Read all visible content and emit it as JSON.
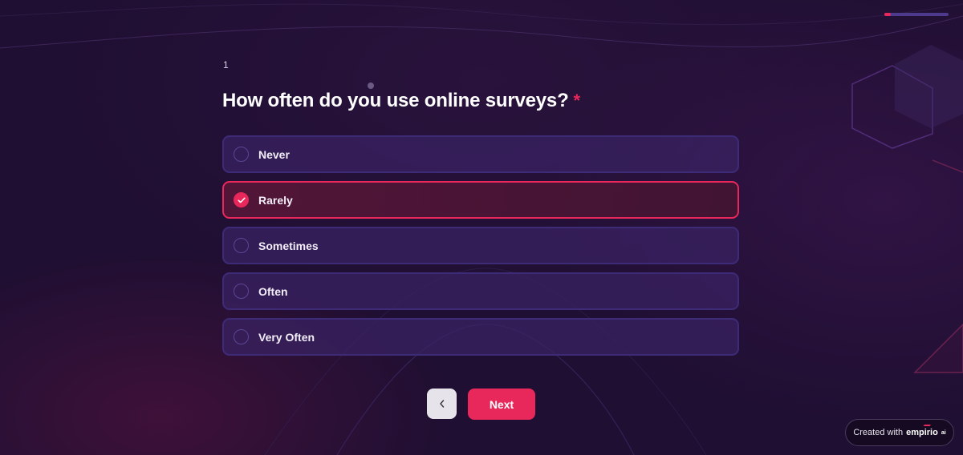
{
  "progress": {
    "fraction": 0.1
  },
  "question": {
    "number": "1",
    "title": "How often do you use online surveys?",
    "required_mark": "*"
  },
  "options": [
    {
      "label": "Never",
      "selected": false
    },
    {
      "label": "Rarely",
      "selected": true
    },
    {
      "label": "Sometimes",
      "selected": false
    },
    {
      "label": "Often",
      "selected": false
    },
    {
      "label": "Very Often",
      "selected": false
    }
  ],
  "navigation": {
    "back_icon": "chevron-left-icon",
    "next_label": "Next"
  },
  "badge": {
    "prefix": "Created with",
    "brand": "empirio",
    "brand_suffix": "ai"
  },
  "colors": {
    "accent": "#e8275a",
    "background": "#1f0f32",
    "option_border": "#3e2b78"
  }
}
